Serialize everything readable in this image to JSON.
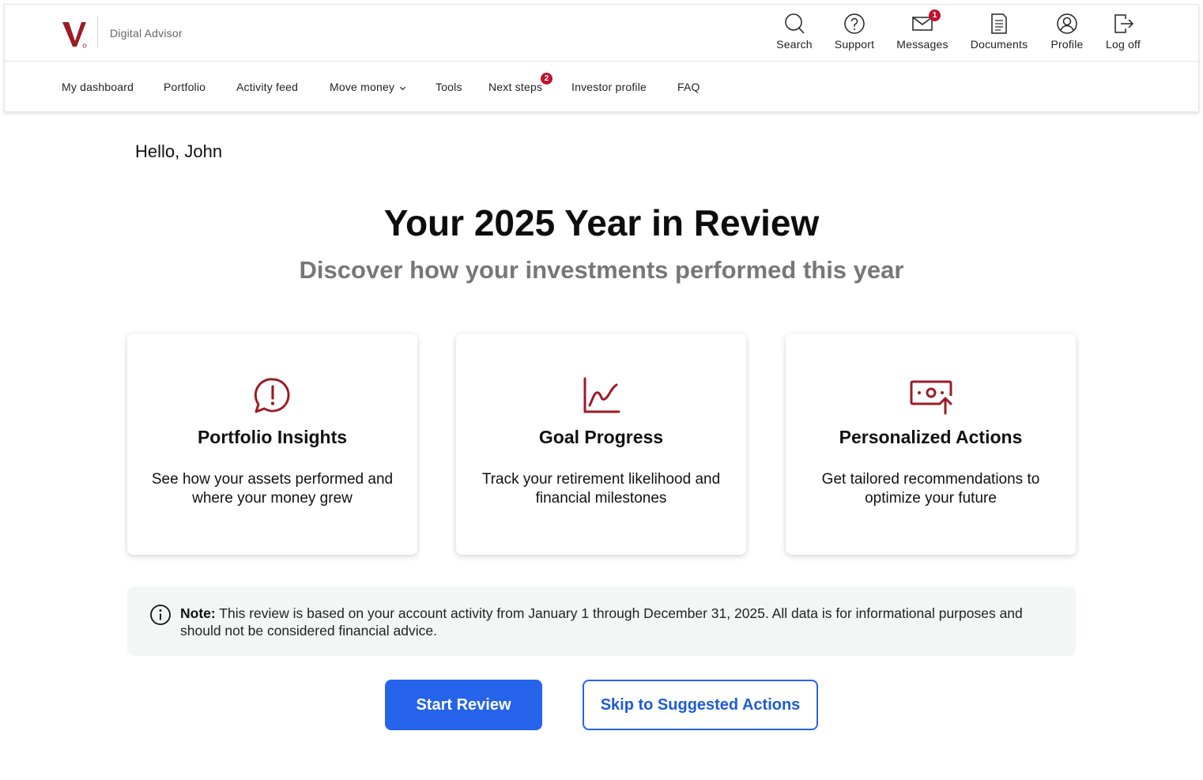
{
  "brand": {
    "logo_letter": "V",
    "name": "Digital Advisor",
    "color": "#9b1c26"
  },
  "utility_nav": [
    {
      "label": "Search",
      "icon": "search-icon"
    },
    {
      "label": "Support",
      "icon": "help-circle-icon"
    },
    {
      "label": "Messages",
      "icon": "envelope-icon",
      "badge": "1"
    },
    {
      "label": "Documents",
      "icon": "document-icon"
    },
    {
      "label": "Profile",
      "icon": "user-circle-icon"
    },
    {
      "label": "Log off",
      "icon": "logout-icon"
    }
  ],
  "main_nav": [
    {
      "label": "My dashboard"
    },
    {
      "label": "Portfolio"
    },
    {
      "label": "Activity feed"
    },
    {
      "label": "Move money",
      "dropdown": true
    },
    {
      "label": "Tools"
    },
    {
      "label": "Next steps",
      "badge": "2"
    },
    {
      "label": "Investor profile"
    },
    {
      "label": "FAQ"
    }
  ],
  "greeting": "Hello, John",
  "hero": {
    "title": "Your 2025 Year in Review",
    "subtitle": "Discover how your investments performed this year"
  },
  "cards": [
    {
      "title": "Portfolio Insights",
      "description": "See how your assets performed and where your money grew",
      "icon": "alert-speech-bubble-icon"
    },
    {
      "title": "Goal Progress",
      "description": "Track your retirement likelihood and financial milestones",
      "icon": "line-chart-icon"
    },
    {
      "title": "Personalized Actions",
      "description": "Get tailored recommendations to optimize your future",
      "icon": "money-up-arrow-icon"
    }
  ],
  "note": {
    "label": "Note:",
    "text": "This review is based on your account activity from January 1 through December 31, 2025. All data is for informational purposes and should not be considered financial advice."
  },
  "buttons": {
    "primary": "Start Review",
    "secondary": "Skip to Suggested Actions"
  },
  "colors": {
    "accent_red": "#9b1c26",
    "badge_red": "#c1122f",
    "primary_blue": "#2563eb"
  }
}
